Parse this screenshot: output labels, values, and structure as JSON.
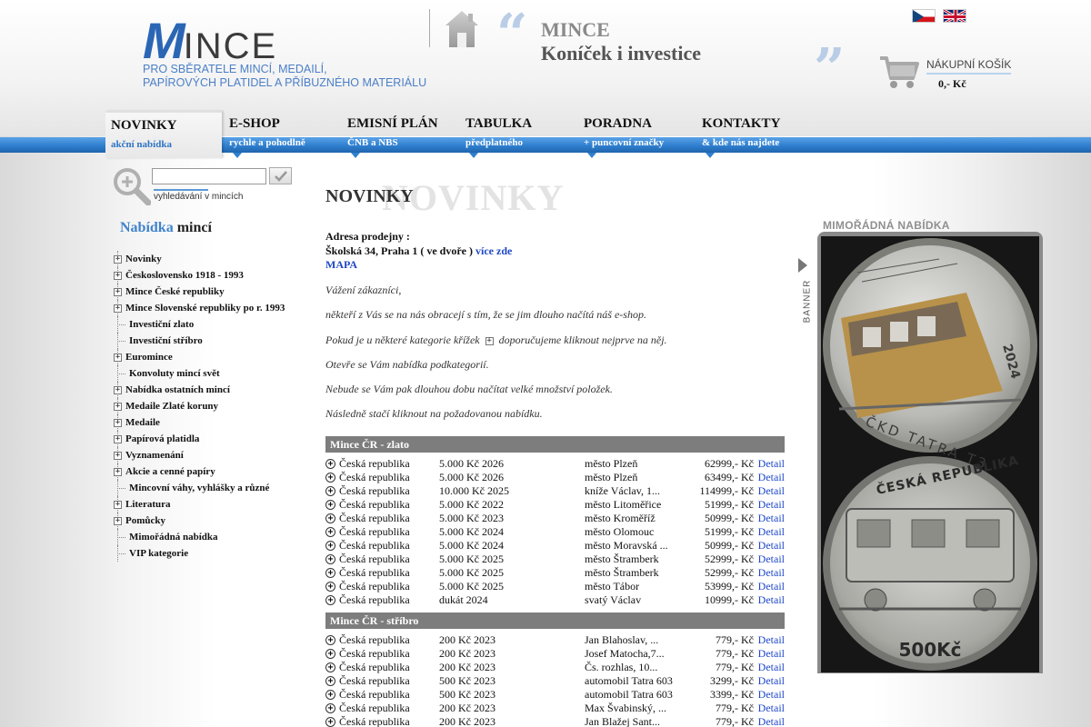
{
  "header": {
    "logo_m": "M",
    "logo_rest": "INCE",
    "tagline_1": "PRO SBĚRATELE MINCÍ, MEDAILÍ,",
    "tagline_2": "PAPÍROVÝCH PLATIDEL A PŘÍBUZNÉHO MATERIÁLU",
    "slogan_title": "MINCE",
    "slogan_sub": "Koníček i investice",
    "cart_label": "NÁKUPNÍ KOŠÍK",
    "cart_total": "0,- Kč"
  },
  "nav": [
    {
      "title": "NOVINKY",
      "sub": "akční nabídka"
    },
    {
      "title": "E-SHOP",
      "sub": "rychle a pohodlně"
    },
    {
      "title": "EMISNÍ PLÁN",
      "sub": "ČNB a NBS"
    },
    {
      "title": "TABULKA",
      "sub": "předplatného"
    },
    {
      "title": "PORADNA",
      "sub": "+ puncovní značky"
    },
    {
      "title": "KONTAKTY",
      "sub": "& kde nás najdete"
    }
  ],
  "search": {
    "placeholder": "",
    "hint": "vyhledávání v mincích"
  },
  "sidebar": {
    "heading_blue": "Nabídka",
    "heading_dark": "mincí",
    "items": [
      {
        "label": "Novinky",
        "expandable": true
      },
      {
        "label": "Československo 1918 - 1993",
        "expandable": true
      },
      {
        "label": "Mince České republiky",
        "expandable": true
      },
      {
        "label": "Mince Slovenské republiky po r. 1993",
        "expandable": true
      },
      {
        "label": "Investiční zlato",
        "expandable": false
      },
      {
        "label": "Investiční stříbro",
        "expandable": false
      },
      {
        "label": "Euromince",
        "expandable": true
      },
      {
        "label": "Konvoluty mincí svět",
        "expandable": false
      },
      {
        "label": "Nabídka ostatních mincí",
        "expandable": true
      },
      {
        "label": "Medaile Zlaté koruny",
        "expandable": true
      },
      {
        "label": "Medaile",
        "expandable": true
      },
      {
        "label": "Papírová platidla",
        "expandable": true
      },
      {
        "label": "Vyznamenání",
        "expandable": true
      },
      {
        "label": "Akcie a cenné papíry",
        "expandable": true
      },
      {
        "label": "Mincovní váhy, vyhlášky a různé",
        "expandable": false
      },
      {
        "label": "Literatura",
        "expandable": true
      },
      {
        "label": "Pomůcky",
        "expandable": true
      },
      {
        "label": "Mimořádná nabídka",
        "expandable": false
      },
      {
        "label": "VIP kategorie",
        "expandable": false
      }
    ]
  },
  "main": {
    "title": "NOVINKY",
    "title_shadow": "NOVINKY",
    "address_label": "Adresa prodejny :",
    "address_line": "Školská 34, Praha 1 ( ve dvoře )",
    "address_more": "více zde",
    "map_link": "MAPA",
    "para_1": "Vážení zákazníci,",
    "para_2": "někteří z Vás se na nás obracejí s tím, že se jim dlouho načítá náš e-shop.",
    "para_3a": "Pokud je u některé kategorie křížek",
    "para_3b": "doporučujeme kliknout nejprve na něj.",
    "para_4": "Otevře se Vám nabídka podkategorií.",
    "para_5": "Nebude se Vám pak dlouhou dobu načítat velké množství položek.",
    "para_6": "Následně stačí kliknout na požadovanou nabídku.",
    "sections": [
      {
        "title": "Mince ČR - zlato",
        "rows": [
          {
            "country": "Česká republika",
            "nominal": "5.000 Kč 2026",
            "name": "město Plzeň",
            "price": "62999,- Kč",
            "detail": "Detail"
          },
          {
            "country": "Česká republika",
            "nominal": "5.000 Kč 2026",
            "name": "město Plzeň",
            "price": "63499,- Kč",
            "detail": "Detail"
          },
          {
            "country": "Česká republika",
            "nominal": "10.000 Kč 2025",
            "name": "kníže Václav, 1...",
            "price": "114999,- Kč",
            "detail": "Detail"
          },
          {
            "country": "Česká republika",
            "nominal": "5.000 Kč 2022",
            "name": "město Litoměřice",
            "price": "51999,- Kč",
            "detail": "Detail"
          },
          {
            "country": "Česká republika",
            "nominal": "5.000 Kč 2023",
            "name": "město Kroměříž",
            "price": "50999,- Kč",
            "detail": "Detail"
          },
          {
            "country": "Česká republika",
            "nominal": "5.000 Kč 2024",
            "name": "město Olomouc",
            "price": "51999,- Kč",
            "detail": "Detail"
          },
          {
            "country": "Česká republika",
            "nominal": "5.000 Kč 2024",
            "name": "město Moravská ...",
            "price": "50999,- Kč",
            "detail": "Detail"
          },
          {
            "country": "Česká republika",
            "nominal": "5.000 Kč 2025",
            "name": "město Štramberk",
            "price": "52999,- Kč",
            "detail": "Detail"
          },
          {
            "country": "Česká republika",
            "nominal": "5.000 Kč 2025",
            "name": "město Štramberk",
            "price": "52999,- Kč",
            "detail": "Detail"
          },
          {
            "country": "Česká republika",
            "nominal": "5.000 Kč 2025",
            "name": "město Tábor",
            "price": "53999,- Kč",
            "detail": "Detail"
          },
          {
            "country": "Česká republika",
            "nominal": "dukát 2024",
            "name": "svatý Václav",
            "price": "10999,- Kč",
            "detail": "Detail"
          }
        ]
      },
      {
        "title": "Mince ČR - stříbro",
        "rows": [
          {
            "country": "Česká republika",
            "nominal": "200 Kč 2023",
            "name": "Jan Blahoslav, ...",
            "price": "779,- Kč",
            "detail": "Detail"
          },
          {
            "country": "Česká republika",
            "nominal": "200 Kč 2023",
            "name": "Josef Matocha,7...",
            "price": "779,- Kč",
            "detail": "Detail"
          },
          {
            "country": "Česká republika",
            "nominal": "200 Kč 2023",
            "name": "Čs. rozhlas, 10...",
            "price": "779,- Kč",
            "detail": "Detail"
          },
          {
            "country": "Česká republika",
            "nominal": "500 Kč 2023",
            "name": "automobil Tatra 603",
            "price": "3299,- Kč",
            "detail": "Detail"
          },
          {
            "country": "Česká republika",
            "nominal": "500 Kč 2023",
            "name": "automobil Tatra 603",
            "price": "3399,- Kč",
            "detail": "Detail"
          },
          {
            "country": "Česká republika",
            "nominal": "200 Kč 2023",
            "name": "Max Švabinský, ...",
            "price": "779,- Kč",
            "detail": "Detail"
          },
          {
            "country": "Česká republika",
            "nominal": "200 Kč 2023",
            "name": "Jan Blažej Sant...",
            "price": "779,- Kč",
            "detail": "Detail"
          }
        ]
      }
    ]
  },
  "banner": {
    "tab_label": "BANNER",
    "special_title": "MIMOŘÁDNÁ NABÍDKA",
    "coin_top_year": "2024",
    "coin_top_text": "ČKD TATRA T3",
    "coin_bottom_text": "ČESKÁ REPUBLIKA",
    "coin_value": "500Kč"
  }
}
